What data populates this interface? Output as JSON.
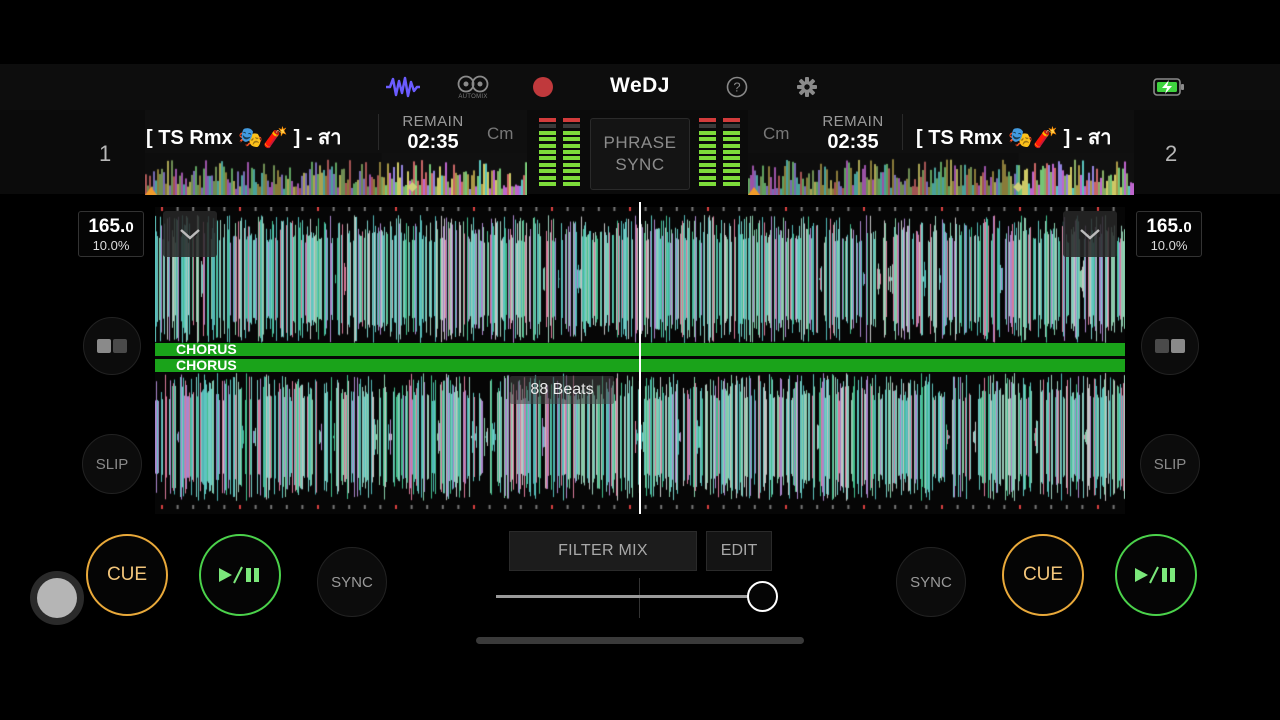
{
  "app": {
    "title": "WeDJ",
    "automix_label": "AUTOMIX"
  },
  "colors": {
    "accent_purple": "#6b5cff",
    "record_red": "#c0393c",
    "cue_orange": "#e9a93a",
    "play_green": "#4bd24b",
    "chorus_green": "#1aa31a",
    "battery_green": "#3fd23f"
  },
  "toolbar": {
    "icons": [
      "waveform-icon",
      "automix-icon",
      "record-icon",
      "help-icon",
      "gear-icon",
      "battery-charging-icon"
    ]
  },
  "deck1": {
    "number": "1",
    "title": "[ TS Rmx 🎭🧨 ] - สา",
    "remain_label": "REMAIN",
    "remain": "02:35",
    "key": "Cm",
    "bpm_whole": "165.",
    "bpm_decimal": "0",
    "pitch": "10.0%",
    "slip_label": "SLIP",
    "cue_label": "CUE",
    "sync_label": "SYNC"
  },
  "deck2": {
    "number": "2",
    "title": "[ TS Rmx 🎭🧨 ] - สา",
    "remain_label": "REMAIN",
    "remain": "02:35",
    "key": "Cm",
    "bpm_whole": "165.",
    "bpm_decimal": "0",
    "pitch": "10.0%",
    "slip_label": "SLIP",
    "cue_label": "CUE",
    "sync_label": "SYNC"
  },
  "phrase_sync": {
    "line1": "PHRASE",
    "line2": "SYNC"
  },
  "waveform": {
    "phrase_top": "CHORUS",
    "phrase_bottom": "CHORUS",
    "beats_label": "88 Beats"
  },
  "mixer": {
    "filter_mix_label": "FILTER MIX",
    "edit_label": "EDIT",
    "crossfader_position": 0.95
  }
}
